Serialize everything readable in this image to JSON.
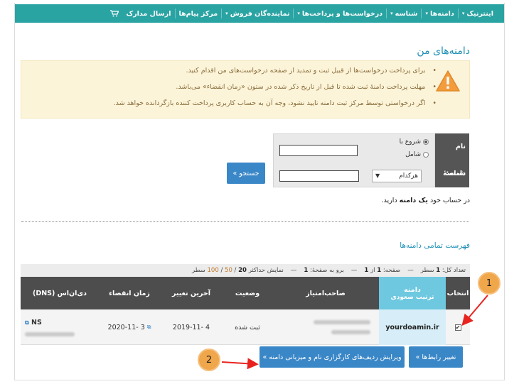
{
  "nav": {
    "items": [
      {
        "label": "اینترنیک",
        "dropdown": true
      },
      {
        "label": "دامنه‌ها",
        "dropdown": true
      },
      {
        "label": "شناسه",
        "dropdown": true
      },
      {
        "label": "درخواست‌ها و پرداخت‌ها",
        "dropdown": true
      },
      {
        "label": "نماینده‌گان فروش",
        "dropdown": true
      },
      {
        "label": "مرکز پیام‌ها",
        "dropdown": false
      },
      {
        "label": "ارسال مدارک",
        "dropdown": false
      }
    ],
    "cart_icon": "cart-icon"
  },
  "page": {
    "title": "دامنه‌های من"
  },
  "alert": {
    "icon": "warning-icon",
    "lines": [
      "برای پرداخت درخواست‌ها از قبیل ثبت و تمدید از صفحه درخواست‌های من اقدام کنید.",
      "مهلت پرداخت دامنهٔ ثبت شده تا قبل از تاریخ ذکر شده در ستون «زمان انقضاء» می‌باشد.",
      "اگر درخواستی توسط مرکز ثبت دامنه تایید نشود، وجه آن به حساب کاربری پرداخت کننده بازگردانده خواهد شد."
    ]
  },
  "search": {
    "domain_label": "نام دامنه:",
    "contact_label": "شناسهٔ رابط:",
    "radio_starts": "شروع با",
    "radio_contains": "شامل",
    "select_value": "هرکدام",
    "button": "جستجو »"
  },
  "count": {
    "prefix": "در حساب خود",
    "bold": "یک دامنه",
    "suffix": "دارید."
  },
  "list_title": "فهرست تمامی دامنه‌ها",
  "info": {
    "total_label": "تعداد کل:",
    "total": "1",
    "total_unit": "سطر",
    "page_label": "صفحه:",
    "page": "1",
    "of": "از",
    "pages": "1",
    "goto_label": "برو به صفحهٔ:",
    "goto": "1",
    "show_label": "نمایش حداکثر",
    "opt20": "20",
    "opt50": "50",
    "opt100": "100",
    "rows_unit": "سطر"
  },
  "table": {
    "headers": {
      "select": "انتخاب",
      "domain": "دامنه",
      "sort": "ترتیب صعودی",
      "holder": "صاحب‌امتیاز",
      "status": "وضعیت",
      "last_change": "آخرین تغییر",
      "expiry": "زمان انقضاء",
      "dns": "دی‌ان‌اس (DNS)"
    },
    "row": {
      "domain": "yourdoamin.ir",
      "status": "ثبت شده",
      "last_change": "2019-11- 4",
      "expiry": "2020-11- 3",
      "dns": "NS"
    }
  },
  "actions": {
    "change_contacts": "تغییر رابط‌ها »",
    "edit_records": "ویرایش ردیف‌های کارگزاری نام و میزبانی دامنه »"
  },
  "badges": {
    "b1": "1",
    "b2": "2"
  },
  "colors": {
    "nav": "#2aa3a3",
    "link": "#1c8fb5",
    "button": "#3a87c8",
    "alert_bg": "#fcf4d9",
    "badge": "#f0a64a",
    "arrow": "#e8231f"
  }
}
